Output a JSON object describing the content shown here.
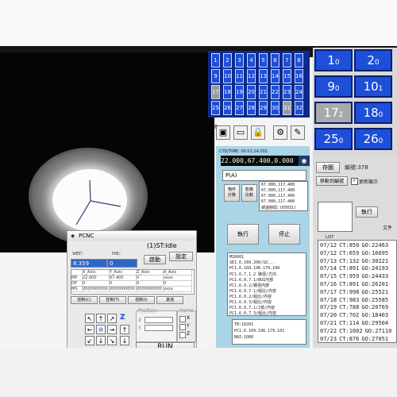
{
  "pcnc": {
    "title": "PCNC",
    "status": "(1)ST:Idle",
    "ver_label": "ver:",
    "no_label": "no:",
    "ver_value": "8.359",
    "no_value": "0",
    "btn_start": "啟動",
    "btn_setup": "設定",
    "col_headers": [
      "X_Axis",
      "Y_Axis",
      "Z_Axis",
      "A_Axis"
    ],
    "row_labels": [
      "MP",
      "OP",
      "MS"
    ],
    "row_values": [
      [
        "22.000",
        "67.400",
        "0",
        "xxxx"
      ],
      [
        "0",
        "0",
        "0",
        "0"
      ],
      [
        "0000000000",
        "0000000000",
        "0000000000",
        "xxxx"
      ]
    ],
    "tabs": [
      "控制(C)",
      "控制(T)",
      "控制(I)",
      "其他"
    ],
    "position_label": "Position",
    "home_label": "Home",
    "axis_labels": [
      "X",
      "Y",
      "Z"
    ],
    "run_label": "RUN"
  },
  "numgrid": {
    "rows": [
      [
        "1",
        "2",
        "3",
        "4",
        "5",
        "6",
        "7",
        "8"
      ],
      [
        "9",
        "10",
        "11",
        "12",
        "13",
        "14",
        "15",
        "16"
      ],
      [
        "17",
        "18",
        "19",
        "20",
        "21",
        "22",
        "23",
        "24"
      ],
      [
        "25",
        "26",
        "27",
        "28",
        "29",
        "30",
        "31",
        "32"
      ]
    ],
    "gray_cells": [
      "17",
      "31"
    ],
    "footer": "F:"
  },
  "bignum": {
    "cells": [
      [
        "1",
        "2"
      ],
      [
        "9",
        "10"
      ],
      [
        "17",
        "18"
      ],
      [
        "25",
        "26"
      ]
    ],
    "subs": [
      [
        "0",
        "0"
      ],
      [
        "0",
        "1"
      ],
      [
        "2",
        "0"
      ],
      [
        "0",
        "0"
      ]
    ],
    "gray_cells": [
      "17"
    ]
  },
  "mid": {
    "ctdtime": "CTD/TIME: 00:01:14.002",
    "coords": "22.000,67.400,0.000",
    "p_label": "P(A)",
    "btn_a": "物件\n計數",
    "btn_b": "影像\n比較",
    "lines": [
      "67.000,117.400",
      "67.000,117.400",
      "67.000,117.400",
      "67.000,117.400",
      "總邊時間:(65031)"
    ],
    "run_button": "執行",
    "stop_button": "停止",
    "log": [
      "M1R001",
      "SE1.6.169.200/1D...",
      "PC1.6.169.196.179.100",
      "PC1.6.7.1.2  路徑/方向",
      "PC1.6.0.7.1/BUI內部",
      "PC1.6.0.2/路徑內部",
      "PC1.6.0.7.1/組比/內容",
      "PC1.6.0.2/組比/內容",
      "PC1.6.0.3/組比/內容",
      "PC1.6.0.7.1/2檢/內容",
      "PC1.6.0.7.3/組比/內容"
    ],
    "bottom_log": [
      "TB:10201",
      "PC1.6.169.196.179.101",
      "BAI:1000"
    ]
  },
  "right": {
    "save_button": "存圖",
    "code_label": "編號:378",
    "move_button": "移動到編號",
    "checkbox_label": "更新顯示",
    "exec_button": "執行",
    "file_label": "文件",
    "list_header": "LIST",
    "rows": [
      [
        "07/12",
        "CT:850",
        "GO:22463"
      ],
      [
        "07/12",
        "CT:659",
        "GO:16695"
      ],
      [
        "07/13",
        "CT:132",
        "GO:30221"
      ],
      [
        "07/14",
        "CT:891",
        "GO:24193"
      ],
      [
        "07/15",
        "CT:959",
        "GO:24433"
      ],
      [
        "07/16",
        "CT:891",
        "GO:26201"
      ],
      [
        "07/17",
        "CT:998",
        "GO:25521"
      ],
      [
        "07/18",
        "CT:983",
        "GO:25585"
      ],
      [
        "07/19",
        "CT:788",
        "GO:20769"
      ],
      [
        "07/20",
        "CT:702",
        "GO:18403"
      ],
      [
        "07/21",
        "CT:114",
        "GO:29504"
      ],
      [
        "07/22",
        "CT:1002",
        "GO:27110"
      ],
      [
        "07/23",
        "CT:876",
        "GO:27051"
      ]
    ]
  }
}
